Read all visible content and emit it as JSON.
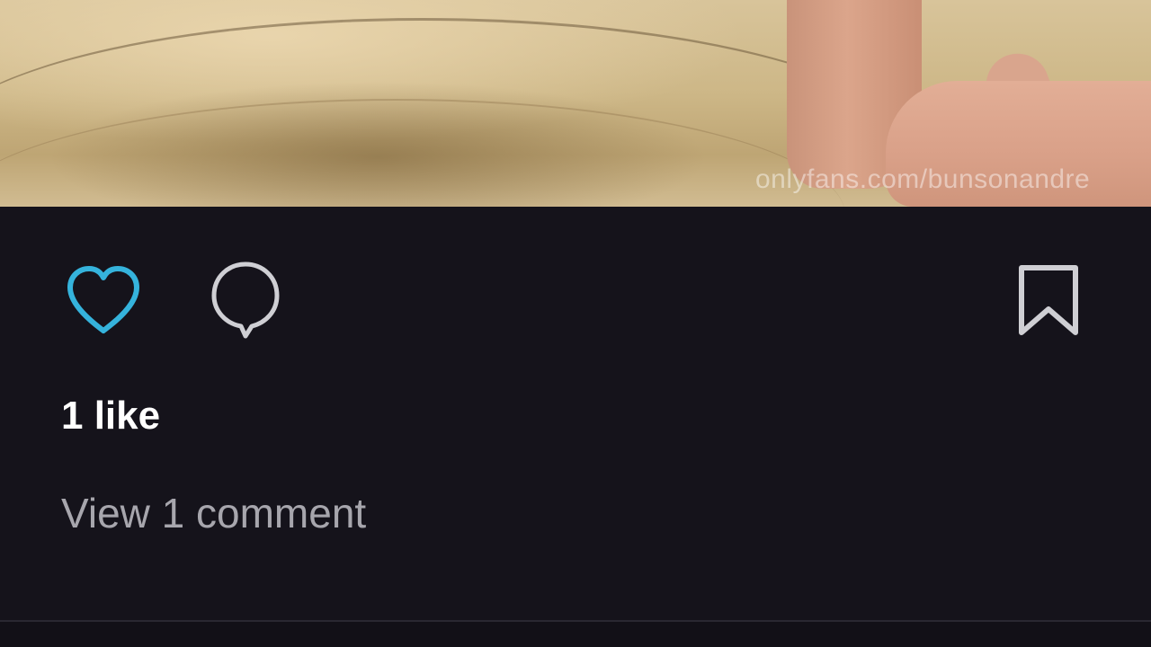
{
  "post": {
    "media": {
      "watermark": "onlyfans.com/bunsonandre"
    },
    "actions": {
      "like_icon": "heart-icon",
      "like_color": "#35b3dc",
      "comment_icon": "comment-icon",
      "save_icon": "bookmark-icon"
    },
    "likes_text": "1 like",
    "view_comments_text": "View 1 comment"
  },
  "colors": {
    "background": "#15131b",
    "like_active": "#35b3dc",
    "icon": "#cfcfd4",
    "muted_text": "#a7a6ad"
  }
}
